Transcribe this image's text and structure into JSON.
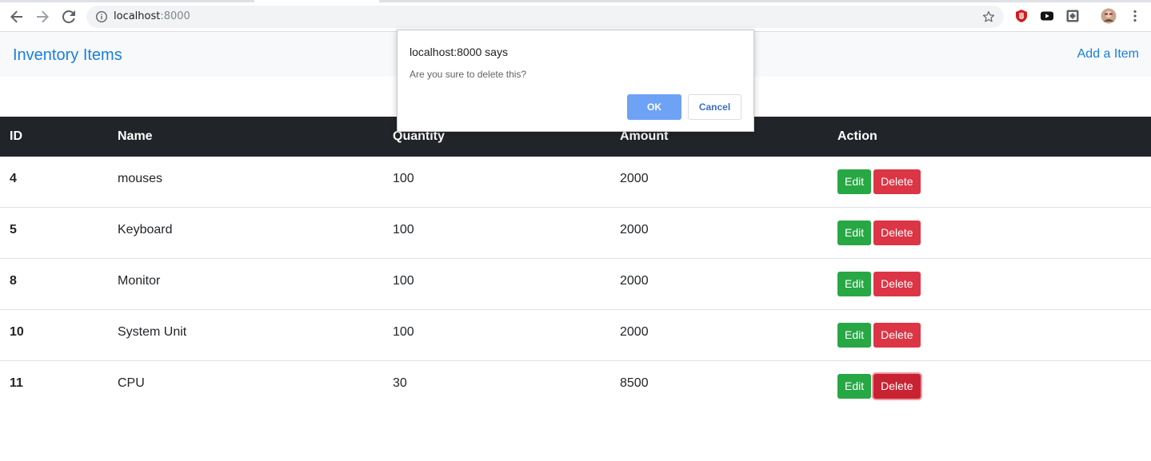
{
  "browser": {
    "url_host": "localhost",
    "url_port": ":8000",
    "icons": [
      "back-icon",
      "forward-icon",
      "reload-icon",
      "info-icon",
      "star-icon",
      "extension-shield-icon",
      "youtube-icon",
      "extension-box-icon",
      "profile-avatar-icon",
      "menu-icon"
    ]
  },
  "navbar": {
    "brand": "Inventory Items",
    "add_link": "Add a Item"
  },
  "table": {
    "headers": [
      "ID",
      "Name",
      "Quantity",
      "Amount",
      "Action"
    ],
    "rows": [
      {
        "id": "4",
        "name": "mouses",
        "quantity": "100",
        "amount": "2000"
      },
      {
        "id": "5",
        "name": "Keyboard",
        "quantity": "100",
        "amount": "2000"
      },
      {
        "id": "8",
        "name": "Monitor",
        "quantity": "100",
        "amount": "2000"
      },
      {
        "id": "10",
        "name": "System Unit",
        "quantity": "100",
        "amount": "2000"
      },
      {
        "id": "11",
        "name": "CPU",
        "quantity": "30",
        "amount": "8500"
      }
    ],
    "edit_label": "Edit",
    "delete_label": "Delete"
  },
  "dialog": {
    "title": "localhost:8000 says",
    "message": "Are you sure to delete this?",
    "ok_label": "OK",
    "cancel_label": "Cancel"
  },
  "colors": {
    "brand": "#1a7fe0",
    "table_header": "#212529",
    "edit": "#28a745",
    "delete": "#dc3545",
    "dialog_ok": "#6ea2f5"
  }
}
